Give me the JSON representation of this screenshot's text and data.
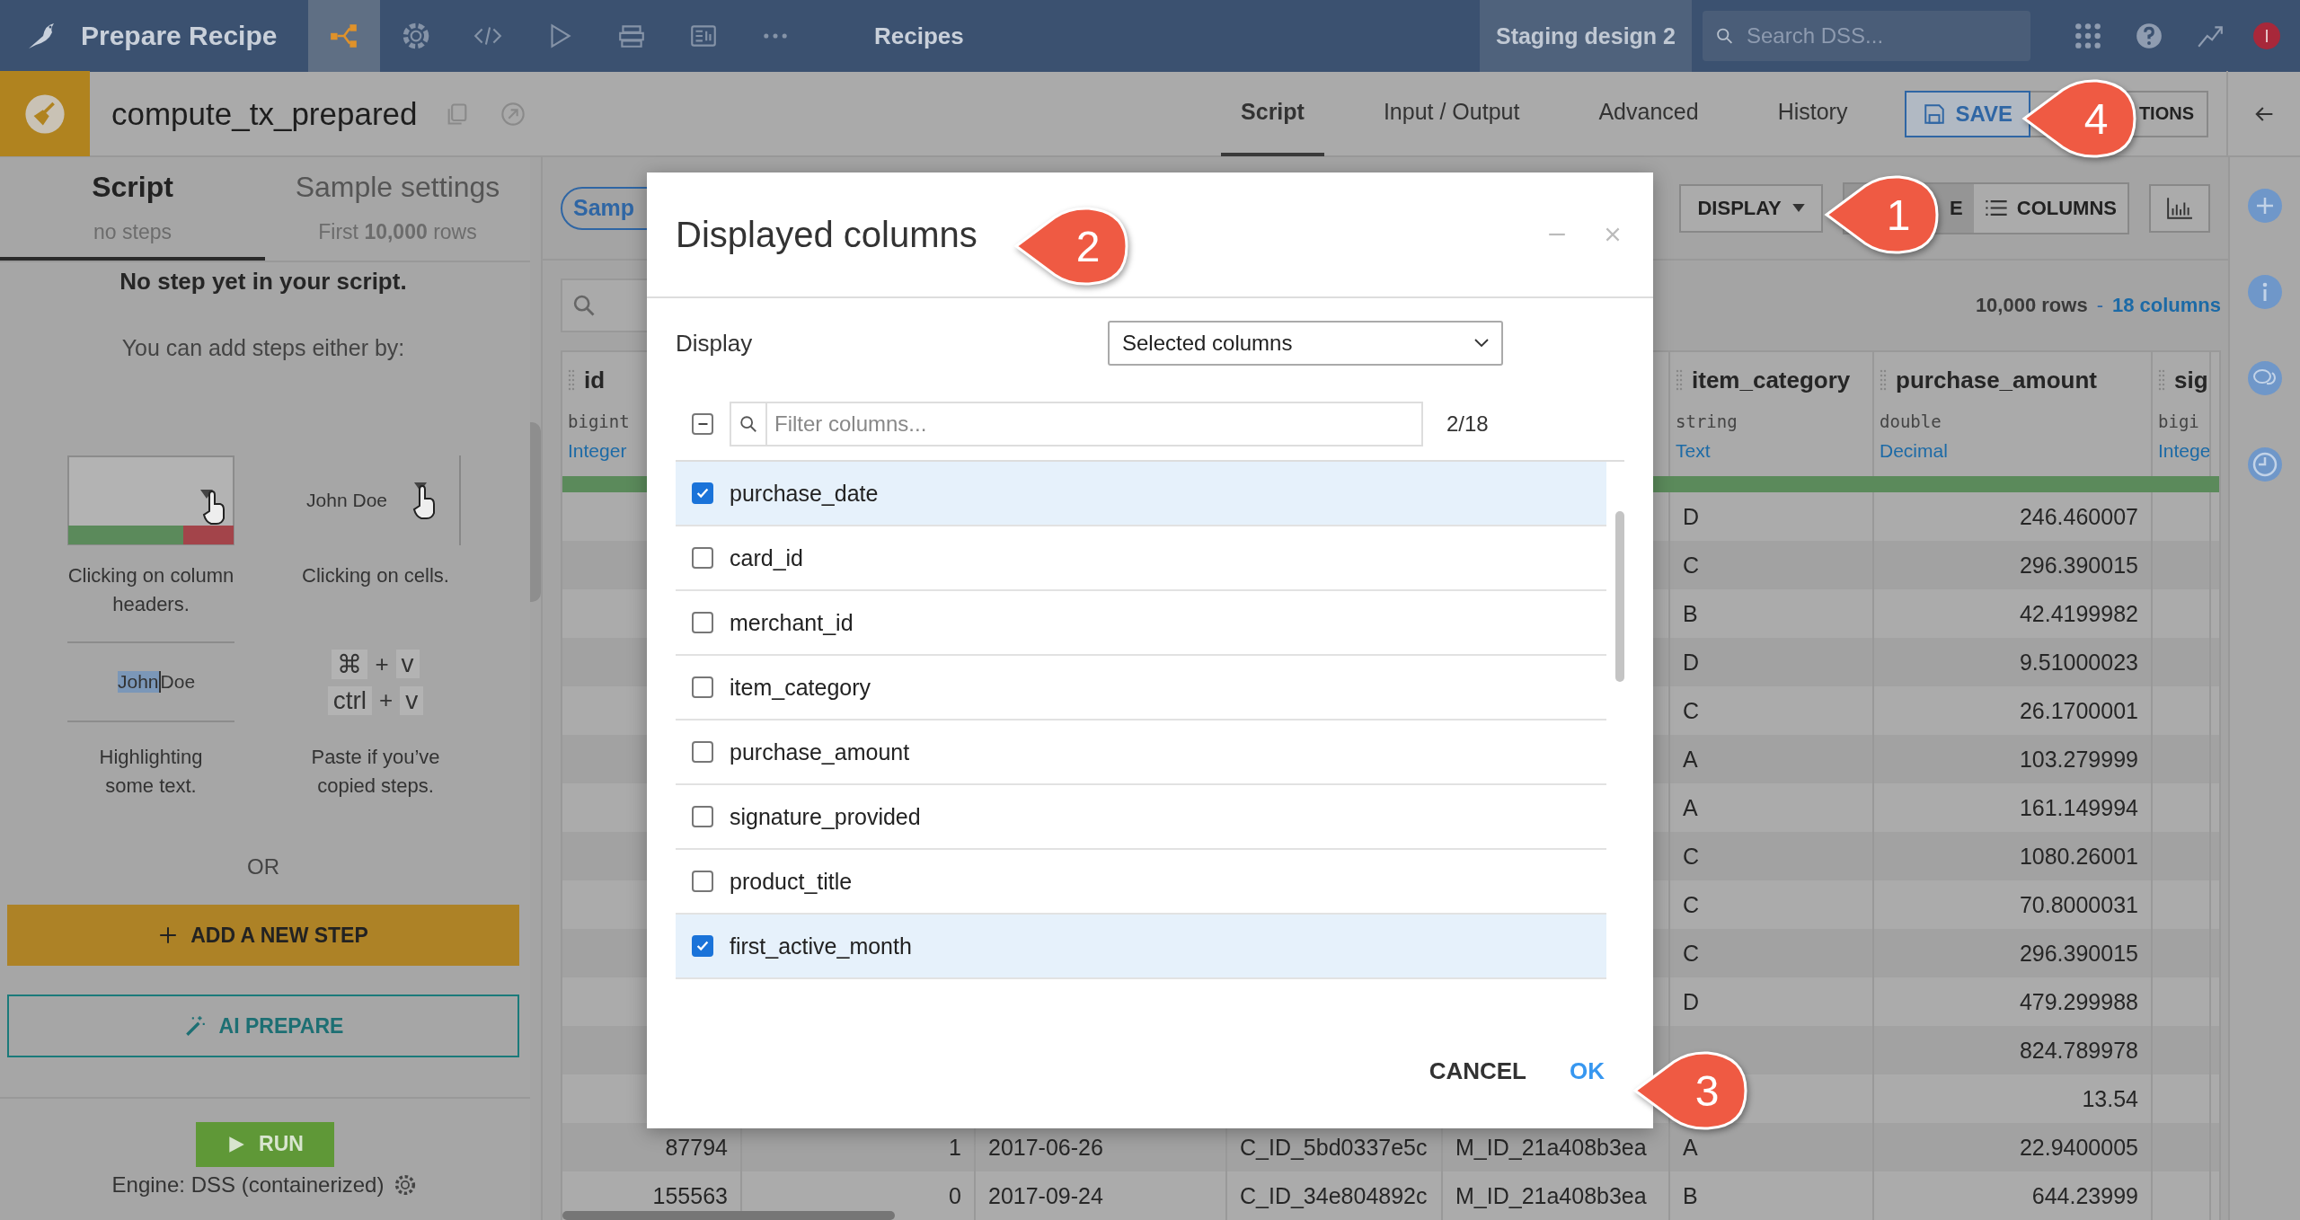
{
  "top_nav": {
    "app_title": "Prepare Recipe",
    "nav_tabs": [
      {
        "kind": "flow",
        "selected": true
      },
      {
        "kind": "gear",
        "selected": false
      },
      {
        "kind": "code",
        "selected": false
      },
      {
        "kind": "play",
        "selected": false
      },
      {
        "kind": "stack",
        "selected": false
      },
      {
        "kind": "dashboard",
        "selected": false
      },
      {
        "kind": "more",
        "selected": false
      }
    ],
    "section": "Recipes",
    "project": "Staging design 2",
    "search": {
      "placeholder": "Search DSS..."
    },
    "avatar": "I"
  },
  "recipe_bar": {
    "name": "compute_tx_prepared",
    "tabs": [
      {
        "label": "Script",
        "selected": true
      },
      {
        "label": "Input / Output",
        "selected": false
      },
      {
        "label": "Advanced",
        "selected": false
      },
      {
        "label": "History",
        "selected": false
      }
    ],
    "save": "SAVE",
    "actions": "TIONS"
  },
  "left_panel": {
    "tabs": [
      {
        "title": "Script",
        "subtitle": "no steps",
        "selected": true
      },
      {
        "title": "Sample settings",
        "subtitle": "First **10,000** rows",
        "selected": false
      }
    ],
    "empty_title": "No step yet in your script.",
    "empty_subtitle": "You can add steps either by:",
    "hints": [
      {
        "kind": "header",
        "caption": "Clicking on column headers."
      },
      {
        "kind": "cell",
        "sample": "John Doe",
        "caption": "Clicking on cells."
      },
      {
        "kind": "highlight",
        "selected_text": "John",
        "rest_text": "Doe",
        "caption": "Highlighting some text."
      },
      {
        "kind": "paste",
        "shortcuts": [
          [
            "⌘",
            "+",
            "v"
          ],
          [
            "ctrl",
            "+",
            "v"
          ]
        ],
        "caption": "Paste if you’ve copied steps."
      }
    ],
    "or": "OR",
    "add_step": "ADD A NEW STEP",
    "ai_prepare": "AI PREPARE",
    "run": "RUN",
    "engine": "Engine: DSS (containerized)"
  },
  "main": {
    "sample_button": "Samp",
    "display_button": "DISPLAY",
    "view_toggle": [
      {
        "label": "E",
        "selected": true
      },
      {
        "label": "COLUMNS",
        "selected": false
      }
    ],
    "rows_info": "10,000 rows",
    "rows_separator": "-",
    "columns_link": "18 columns",
    "table": {
      "columns": [
        {
          "name": "id",
          "type": "bigint",
          "meaning": "Integer"
        },
        {
          "name": "item_category",
          "type": "string",
          "meaning": "Text"
        },
        {
          "name": "purchase_amount",
          "type": "double",
          "meaning": "Decimal"
        },
        {
          "name": "sig",
          "type": "bigi",
          "meaning": "Intege"
        }
      ],
      "rows": [
        {
          "item_category": "D",
          "purchase_amount": "246.460007"
        },
        {
          "item_category": "C",
          "purchase_amount": "296.390015"
        },
        {
          "item_category": "B",
          "purchase_amount": "42.4199982"
        },
        {
          "item_category": "D",
          "purchase_amount": "9.51000023"
        },
        {
          "item_category": "C",
          "purchase_amount": "26.1700001"
        },
        {
          "item_category": "A",
          "purchase_amount": "103.279999"
        },
        {
          "item_category": "A",
          "purchase_amount": "161.149994"
        },
        {
          "item_category": "C",
          "purchase_amount": "1080.26001"
        },
        {
          "item_category": "C",
          "purchase_amount": "70.8000031"
        },
        {
          "item_category": "C",
          "purchase_amount": "296.390015"
        },
        {
          "item_category": "D",
          "purchase_amount": "479.299988"
        },
        {
          "purchase_amount": "824.789978"
        },
        {
          "purchase_amount": "13.54"
        },
        {
          "id": "87794",
          "column_2": "1",
          "column_3": "2017-06-26",
          "column_4": "C_ID_5bd0337e5c",
          "column_5": "M_ID_21a408b3ea",
          "item_category": "A",
          "purchase_amount": "22.9400005"
        },
        {
          "id": "155563",
          "column_2": "0",
          "column_3": "2017-09-24",
          "column_4": "C_ID_34e804892c",
          "column_5": "M_ID_21a408b3ea",
          "item_category": "B",
          "purchase_amount": "644.23999"
        }
      ]
    }
  },
  "dialog": {
    "title": "Displayed columns",
    "display_label": "Display",
    "display_select": "Selected columns",
    "select_all_indeterminate": true,
    "filter": {
      "placeholder": "Filter columns..."
    },
    "count": "2/18",
    "columns": [
      {
        "name": "purchase_date",
        "checked": true
      },
      {
        "name": "card_id",
        "checked": false
      },
      {
        "name": "merchant_id",
        "checked": false
      },
      {
        "name": "item_category",
        "checked": false
      },
      {
        "name": "purchase_amount",
        "checked": false
      },
      {
        "name": "signature_provided",
        "checked": false
      },
      {
        "name": "product_title",
        "checked": false
      },
      {
        "name": "first_active_month",
        "checked": true
      }
    ],
    "buttons": [
      {
        "label": "CANCEL",
        "kind": "cancel"
      },
      {
        "label": "OK",
        "kind": "ok"
      }
    ]
  },
  "callouts": [
    {
      "number": "1"
    },
    {
      "number": "2"
    },
    {
      "number": "3"
    },
    {
      "number": "4"
    }
  ]
}
